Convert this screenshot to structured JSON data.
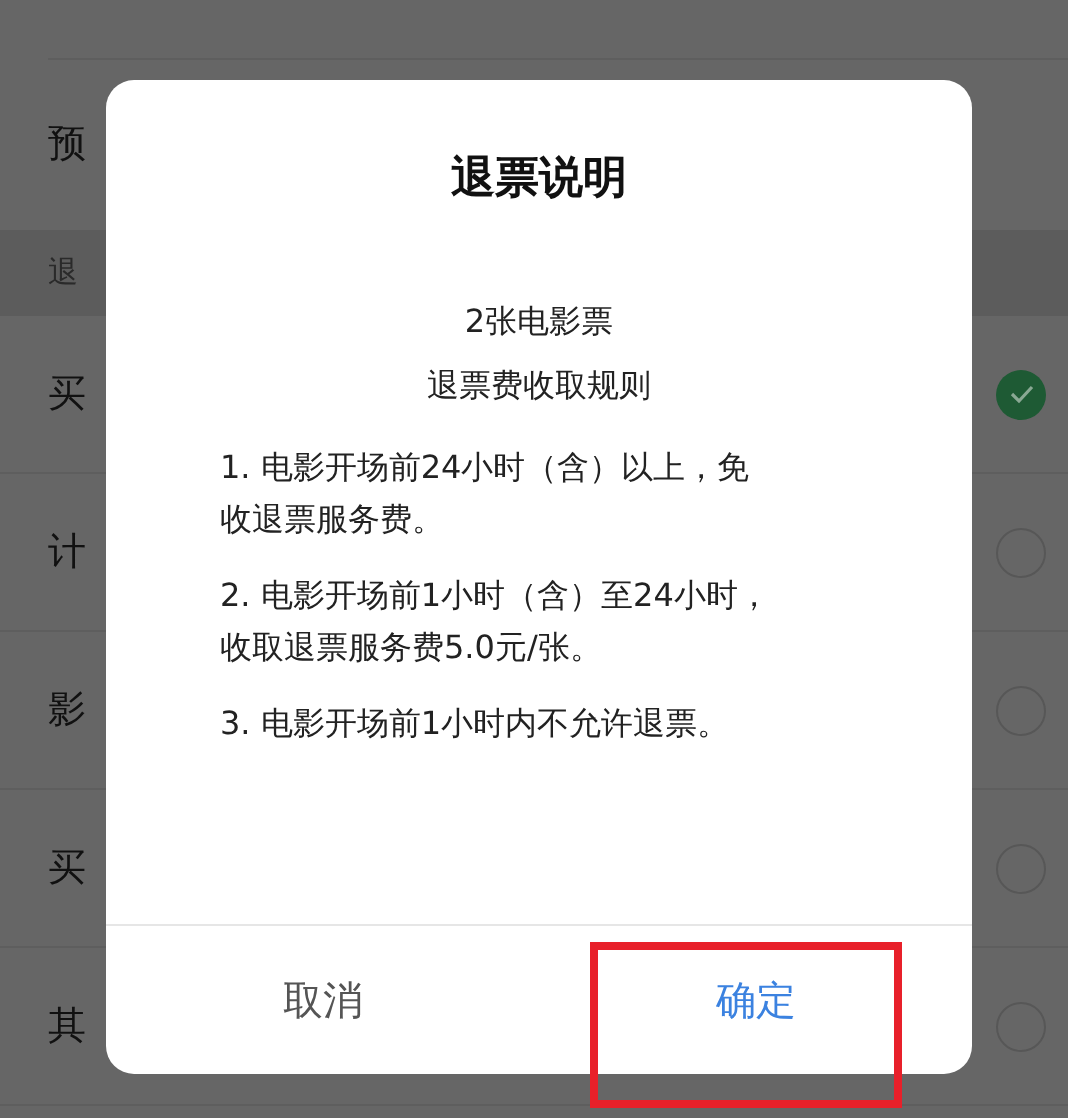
{
  "background": {
    "top_row": {
      "label": "预"
    },
    "section_header": "退",
    "options": [
      {
        "label": "买",
        "selected": true
      },
      {
        "label": "计",
        "selected": false
      },
      {
        "label": "影",
        "selected": false
      },
      {
        "label": "买",
        "selected": false
      },
      {
        "label": "其",
        "selected": false
      }
    ]
  },
  "dialog": {
    "title": "退票说明",
    "subtitle_lines": [
      "2张电影票",
      "退票费收取规则"
    ],
    "rules": [
      "1. 电影开场前24小时（含）以上，免收退票服务费。",
      "2. 电影开场前1小时（含）至24小时，收取退票服务费5.0元/张。",
      "3. 电影开场前1小时内不允许退票。"
    ],
    "buttons": [
      {
        "label": "取消",
        "kind": "cancel",
        "highlighted": false
      },
      {
        "label": "确定",
        "kind": "confirm",
        "highlighted": true
      }
    ]
  }
}
